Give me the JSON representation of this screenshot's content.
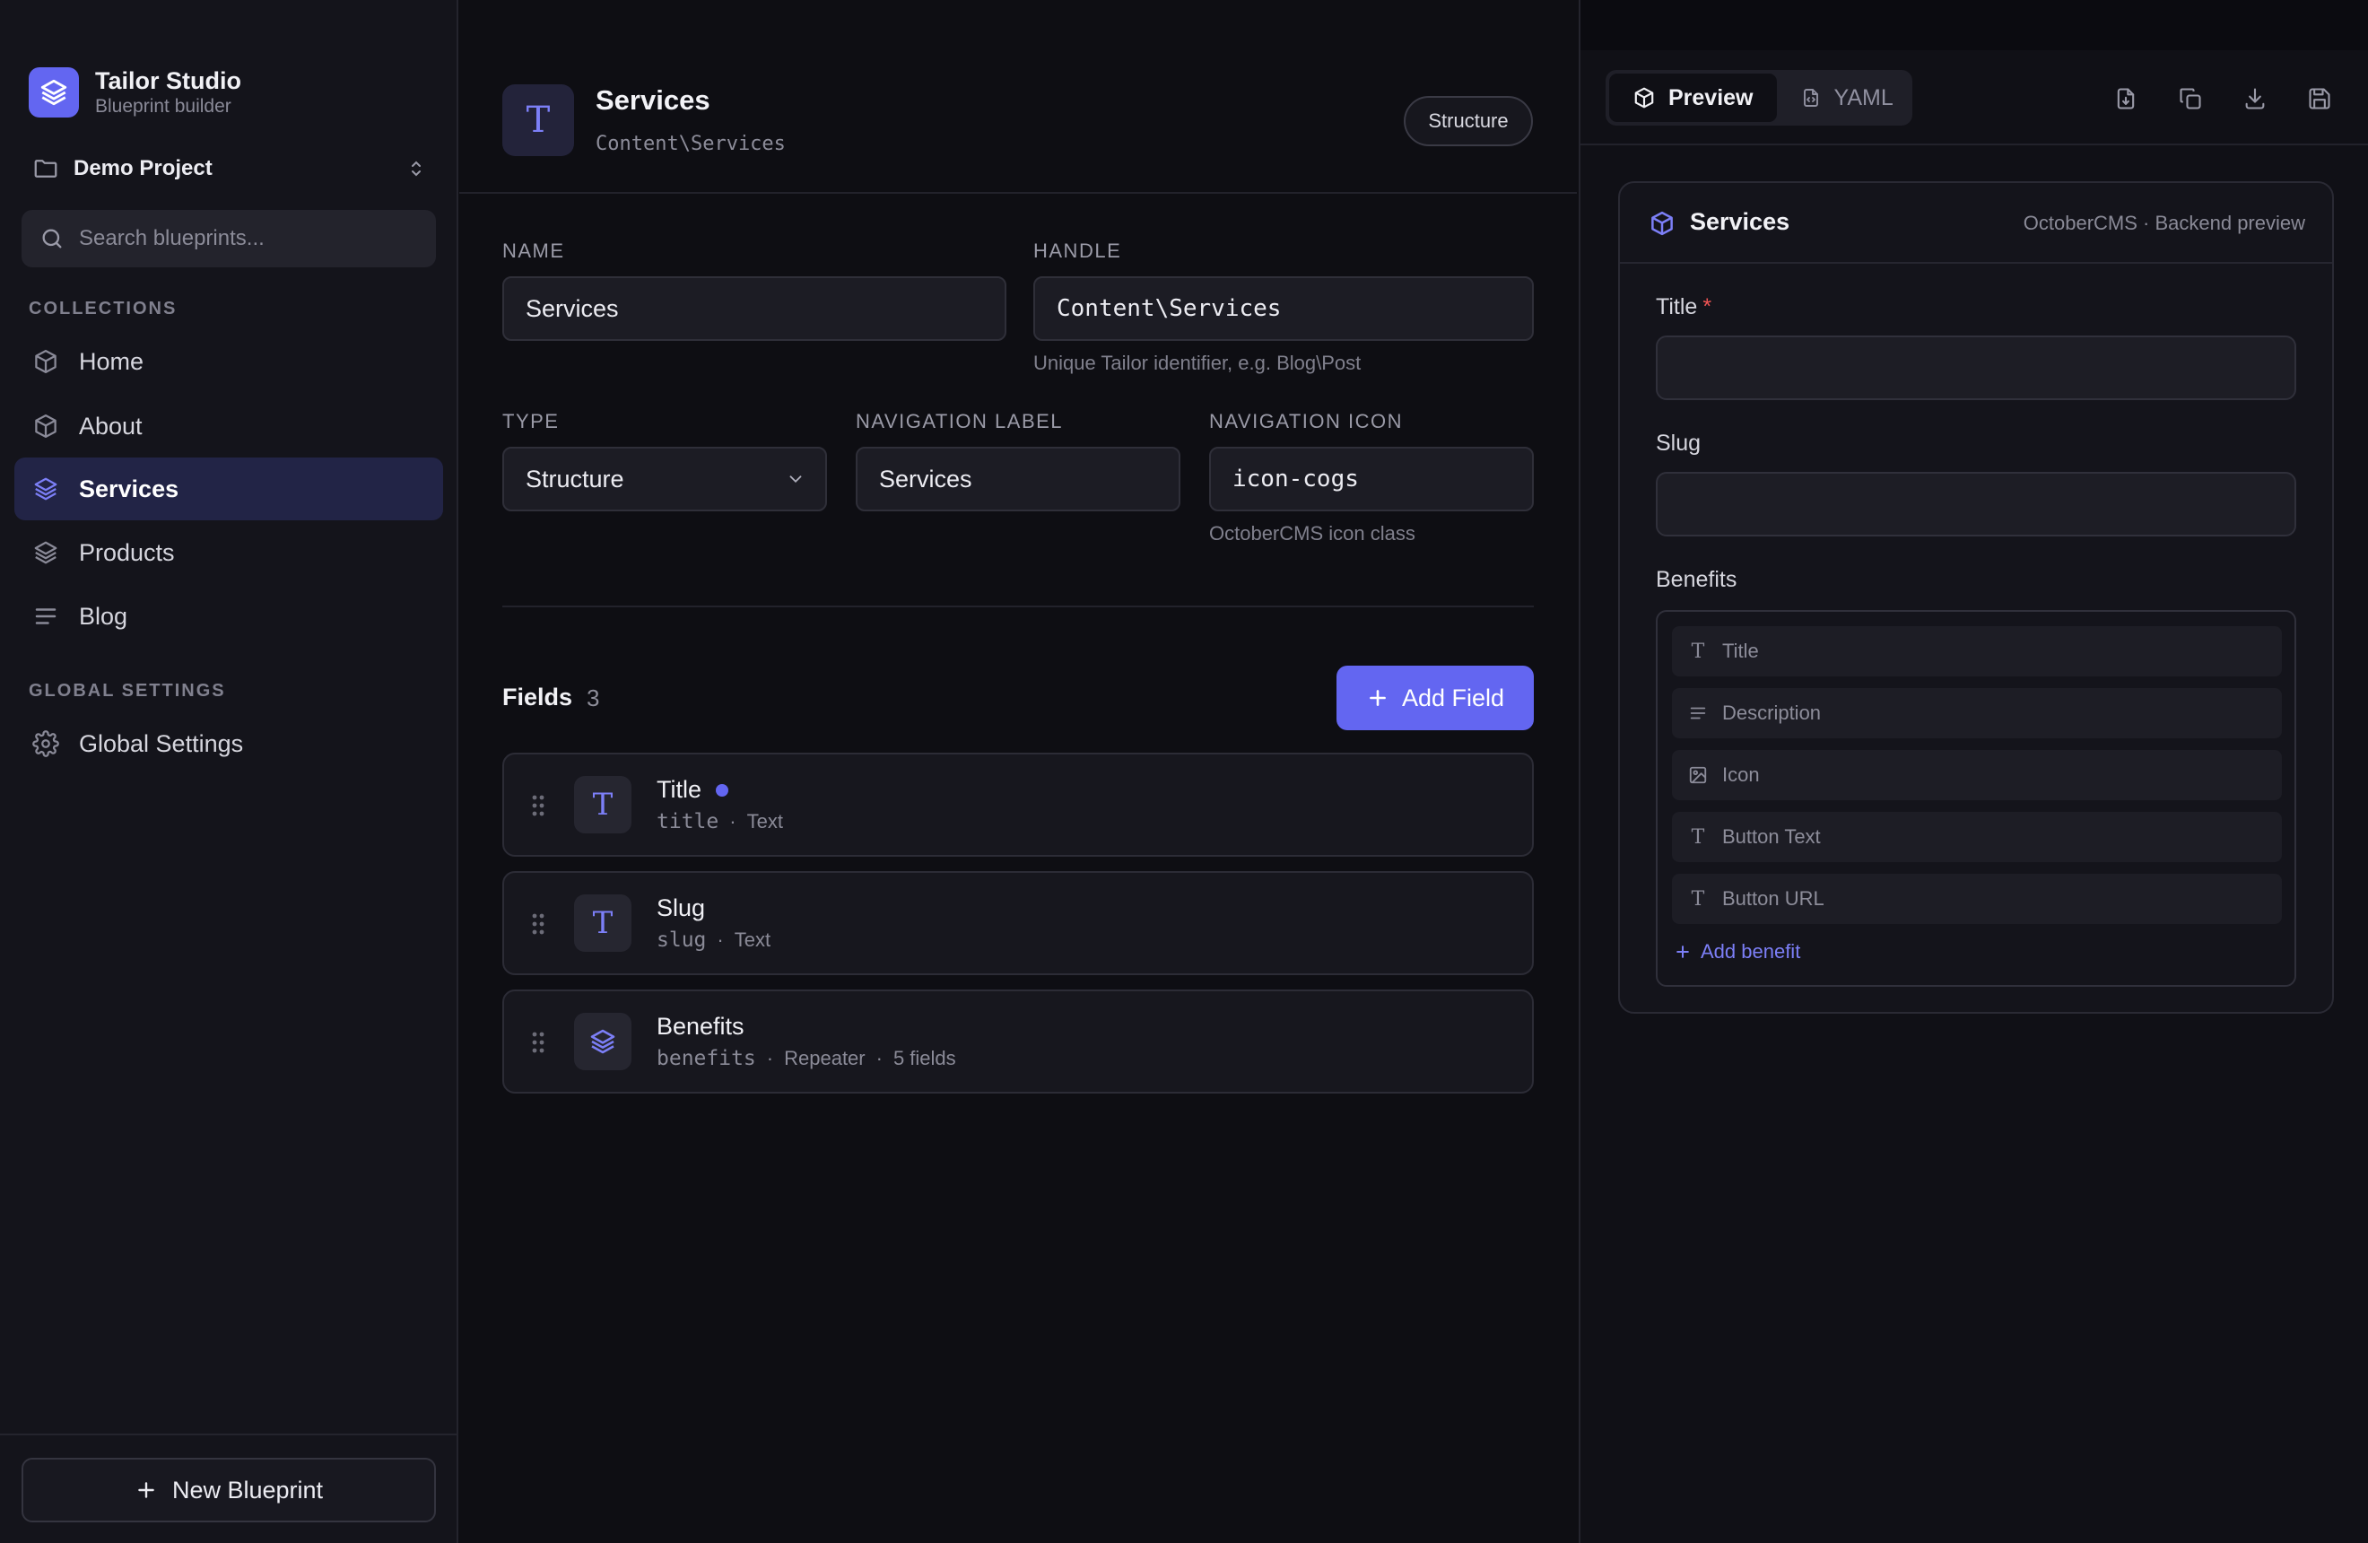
{
  "brand": {
    "title": "Tailor Studio",
    "subtitle": "Blueprint builder"
  },
  "project": {
    "name": "Demo Project"
  },
  "search": {
    "placeholder": "Search blueprints..."
  },
  "sidebar": {
    "collections_label": "COLLECTIONS",
    "collections": [
      {
        "label": "Home",
        "icon": "cube-icon"
      },
      {
        "label": "About",
        "icon": "cube-icon"
      },
      {
        "label": "Services",
        "icon": "layers-icon",
        "active": true
      },
      {
        "label": "Products",
        "icon": "layers-icon"
      },
      {
        "label": "Blog",
        "icon": "list-icon"
      }
    ],
    "global_label": "GLOBAL SETTINGS",
    "global": [
      {
        "label": "Global Settings",
        "icon": "gear-icon"
      }
    ],
    "new_blueprint": "New Blueprint"
  },
  "header": {
    "icon_letter": "T",
    "title": "Services",
    "handle": "Content\\Services",
    "badge": "Structure"
  },
  "form": {
    "name_label": "NAME",
    "name_value": "Services",
    "handle_label": "HANDLE",
    "handle_value": "Content\\Services",
    "handle_help": "Unique Tailor identifier, e.g. Blog\\Post",
    "type_label": "TYPE",
    "type_value": "Structure",
    "navlabel_label": "NAVIGATION LABEL",
    "navlabel_value": "Services",
    "navicon_label": "NAVIGATION ICON",
    "navicon_value": "icon-cogs",
    "navicon_help": "OctoberCMS icon class"
  },
  "fields": {
    "title": "Fields",
    "count": "3",
    "add_label": "Add Field",
    "items": [
      {
        "name": "Title",
        "handle": "title",
        "type": "Text",
        "extra": "",
        "required": true,
        "icon": "text-icon"
      },
      {
        "name": "Slug",
        "handle": "slug",
        "type": "Text",
        "extra": "",
        "required": false,
        "icon": "text-icon"
      },
      {
        "name": "Benefits",
        "handle": "benefits",
        "type": "Repeater",
        "extra": "5 fields",
        "required": false,
        "icon": "layers-icon"
      }
    ]
  },
  "preview": {
    "tabs": {
      "preview": "Preview",
      "yaml": "YAML"
    },
    "toolbar_icons": [
      "file-download-icon",
      "copy-icon",
      "download-icon",
      "save-icon"
    ],
    "card_title": "Services",
    "card_meta": "OctoberCMS · Backend preview",
    "title_label": "Title",
    "required_mark": "*",
    "slug_label": "Slug",
    "benefits_label": "Benefits",
    "benefit_fields": [
      {
        "label": "Title",
        "icon": "text-icon"
      },
      {
        "label": "Description",
        "icon": "textarea-icon"
      },
      {
        "label": "Icon",
        "icon": "image-icon"
      },
      {
        "label": "Button Text",
        "icon": "text-icon"
      },
      {
        "label": "Button URL",
        "icon": "text-icon"
      }
    ],
    "add_benefit": "Add benefit"
  },
  "colors": {
    "accent": "#6366f1",
    "required": "#f05454",
    "background": "#0e0e13",
    "sidebar": "#14141b"
  }
}
